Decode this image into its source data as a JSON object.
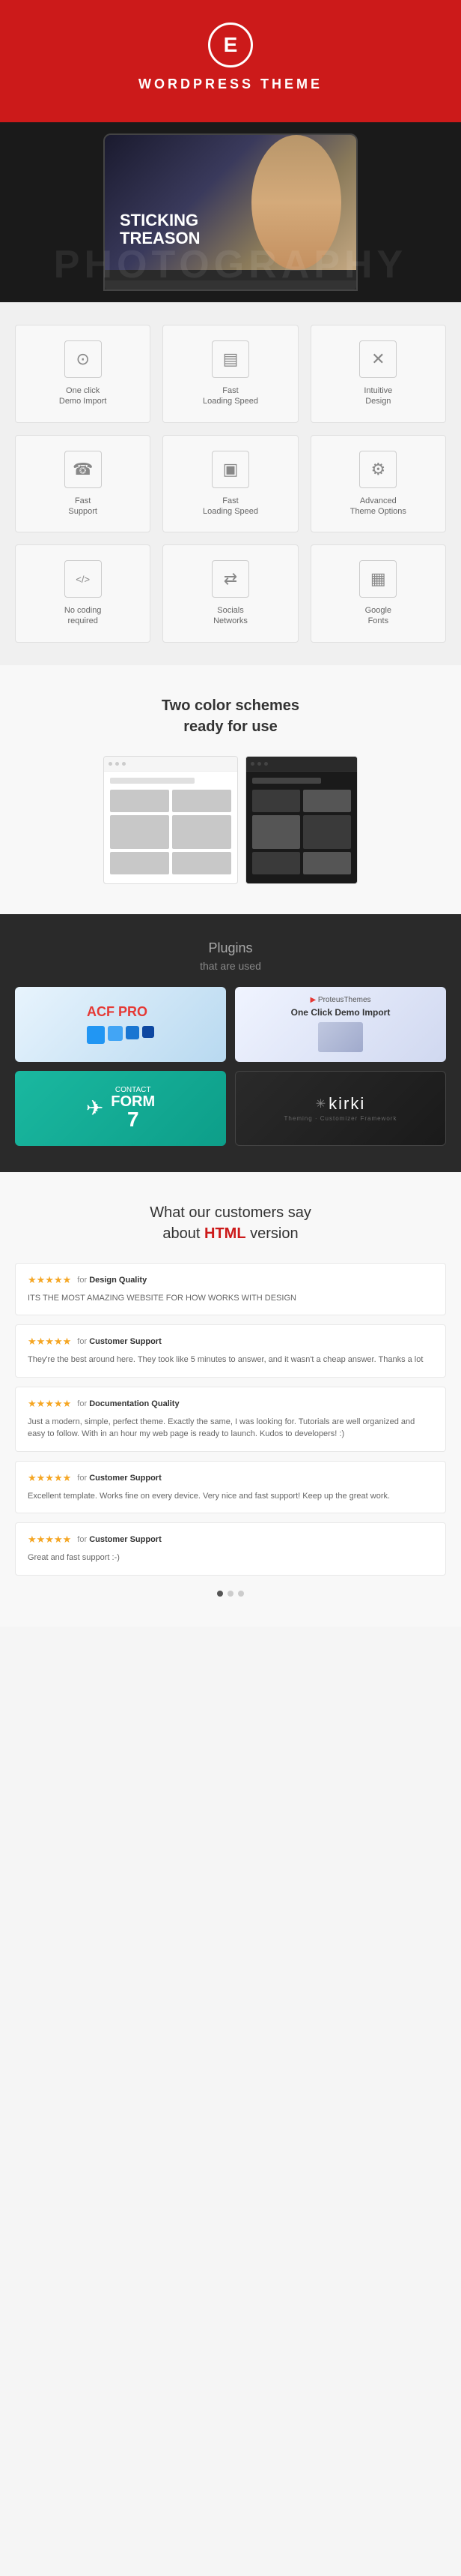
{
  "header": {
    "logo_letter": "E",
    "title": "WORDPRESS THEME"
  },
  "hero": {
    "text_line1": "STICKING",
    "text_line2": "TREASON",
    "watermark": "PHOTOGRAPHY"
  },
  "features": [
    {
      "id": "one-click-demo",
      "icon": "⊙",
      "label": "One click\nDemo Import"
    },
    {
      "id": "fast-loading-1",
      "icon": "▤",
      "label": "Fast\nLoading Speed"
    },
    {
      "id": "intuitive-design",
      "icon": "✕",
      "label": "Intuitive\nDesign"
    },
    {
      "id": "fast-support",
      "icon": "☎",
      "label": "Fast\nSupport"
    },
    {
      "id": "fast-loading-2",
      "icon": "▣",
      "label": "Fast\nLoading Speed"
    },
    {
      "id": "advanced-theme",
      "icon": "⚙",
      "label": "Advanced\nTheme Options"
    },
    {
      "id": "no-coding",
      "icon": "</>",
      "label": "No coding\nrequired"
    },
    {
      "id": "socials",
      "icon": "⇄",
      "label": "Socials\nNetworks"
    },
    {
      "id": "google-fonts",
      "icon": "▦",
      "label": "Google\nFonts"
    }
  ],
  "color_schemes": {
    "title": "Two color schemes\nready for use"
  },
  "plugins": {
    "title": "Plugins",
    "subtitle": "that are used",
    "items": [
      {
        "id": "acf-pro",
        "name": "ACF PRO",
        "type": "acf"
      },
      {
        "id": "one-click-demo-import",
        "name": "One Click Demo Import",
        "type": "demo"
      },
      {
        "id": "contact-form-7",
        "name": "CONTACT FORM 7",
        "type": "cf7"
      },
      {
        "id": "kirki",
        "name": "kirki",
        "type": "kirki"
      }
    ]
  },
  "reviews": {
    "title_line1": "What our customers say",
    "title_line2": "about",
    "title_highlight": "HTML",
    "title_line3": "version",
    "items": [
      {
        "stars": "★★★★★",
        "for_label": "for",
        "category": "Design Quality",
        "text": "ITS THE MOST AMAZING WEBSITE FOR HOW WORKS WITH DESIGN"
      },
      {
        "stars": "★★★★★",
        "for_label": "for",
        "category": "Customer Support",
        "text": "They're the best around here. They took like 5 minutes to answer, and it wasn't a cheap answer. Thanks a lot"
      },
      {
        "stars": "★★★★★",
        "for_label": "for",
        "category": "Documentation Quality",
        "text": "Just a modern, simple, perfect theme. Exactly the same, I was looking for. Tutorials are well organized and easy to follow. With in an hour my web page is ready to launch. Kudos to developers! :)"
      },
      {
        "stars": "★★★★★",
        "for_label": "for",
        "category": "Customer Support",
        "text": "Excellent template. Works fine on every device. Very nice and fast support! Keep up the great work."
      },
      {
        "stars": "★★★★★",
        "for_label": "for",
        "category": "Customer Support",
        "text": "Great and fast support :-)"
      }
    ],
    "pagination": {
      "active": 0,
      "total": 3
    }
  }
}
